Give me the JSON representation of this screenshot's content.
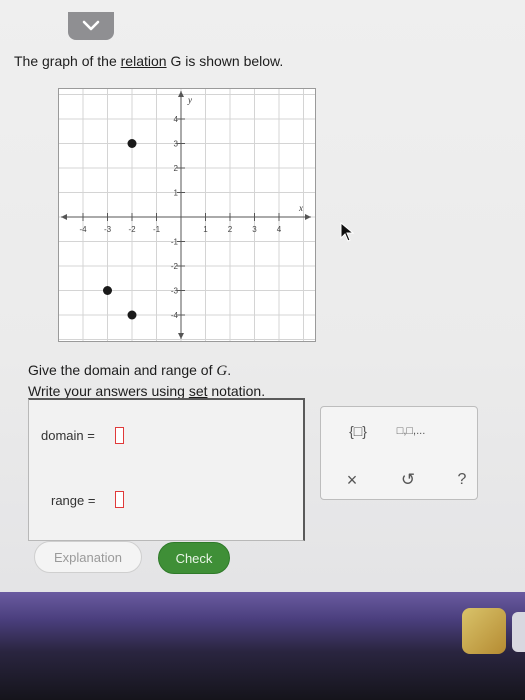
{
  "prompt": {
    "part1": "The graph of the ",
    "link": "relation",
    "part2": " G is shown below.",
    "var": "G"
  },
  "graph": {
    "x_axis_label": "x",
    "y_axis_label": "y",
    "x_ticks": [
      -4,
      -3,
      -2,
      -1,
      1,
      2,
      3,
      4
    ],
    "y_ticks": [
      -4,
      -3,
      -2,
      -1,
      1,
      2,
      3,
      4
    ],
    "points": [
      [
        -2,
        3
      ],
      [
        -3,
        -3
      ],
      [
        -2,
        -4
      ]
    ]
  },
  "question": {
    "line1_a": "Give the domain and range of ",
    "line1_var": "G",
    "line1_b": ".",
    "line2_a": "Write your answers using ",
    "line2_link": "set",
    "line2_b": " notation."
  },
  "answers": {
    "domain_label": "domain =",
    "range_label": "range ="
  },
  "tools": {
    "set_braces": "{□}",
    "list": "□,□,...",
    "clear": "×",
    "undo": "↺",
    "help": "?"
  },
  "buttons": {
    "explanation": "Explanation",
    "check": "Check"
  },
  "colors": {
    "check_green": "#3f8f37",
    "slot_red": "#e03a3a"
  }
}
